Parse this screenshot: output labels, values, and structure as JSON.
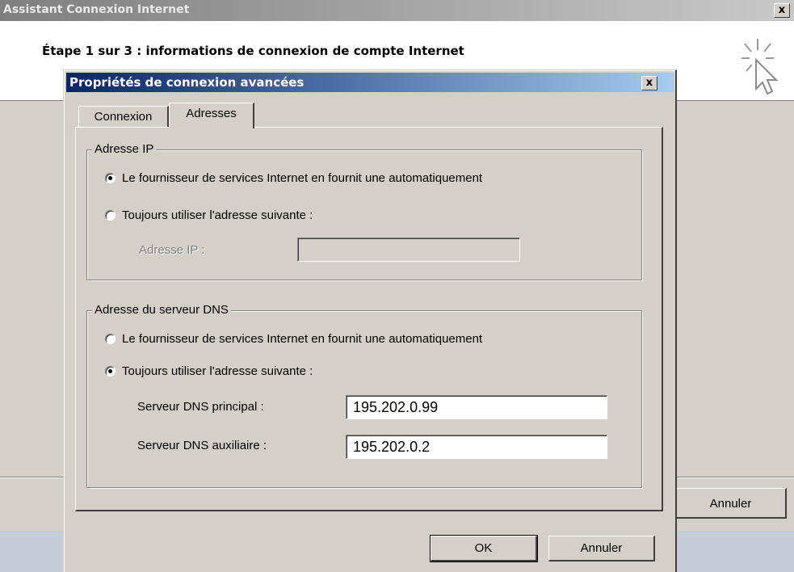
{
  "wizard": {
    "title": "Assistant Connexion Internet",
    "close_label": "x",
    "step": "Étape 1 sur 3 : informations de connexion de compte Internet",
    "cancel_label": "Annuler",
    "header_icon": "cursor-click-icon"
  },
  "dialog": {
    "title": "Propriétés de connexion avancées",
    "close_label": "x",
    "tabs": [
      {
        "label": "Connexion",
        "selected": false
      },
      {
        "label": "Adresses",
        "selected": true
      }
    ],
    "ip_group": {
      "legend": "Adresse IP",
      "option_auto": "Le fournisseur de services Internet en fournit une automatiquement",
      "option_manual": "Toujours utiliser l'adresse suivante :",
      "selected": "auto",
      "ip_label": "Adresse IP :",
      "ip_value": ""
    },
    "dns_group": {
      "legend": "Adresse du serveur DNS",
      "option_auto": "Le fournisseur de services Internet en fournit une automatiquement",
      "option_manual": "Toujours utiliser l'adresse suivante :",
      "selected": "manual",
      "primary_label": "Serveur DNS principal :",
      "primary_value": "195.202.0.99",
      "secondary_label": "Serveur DNS auxiliaire :",
      "secondary_value": "195.202.0.2"
    },
    "ok_label": "OK",
    "cancel_label": "Annuler"
  }
}
